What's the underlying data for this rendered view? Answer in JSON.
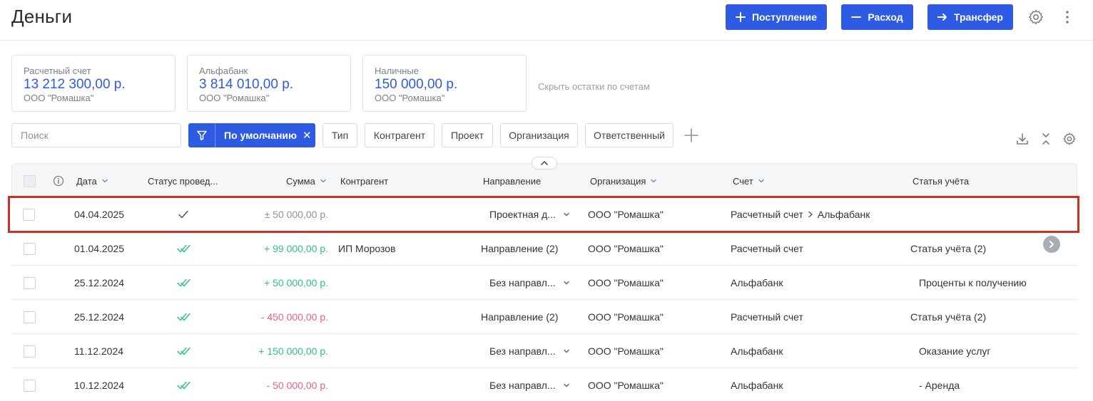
{
  "header": {
    "title": "Деньги",
    "income_label": "Поступление",
    "expense_label": "Расход",
    "transfer_label": "Трансфер"
  },
  "accounts": [
    {
      "name": "Расчетный счет",
      "amount": "13 212 300,00 р.",
      "org": "ООО \"Ромашка\""
    },
    {
      "name": "Альфабанк",
      "amount": "3 814 010,00 р.",
      "org": "ООО \"Ромашка\""
    },
    {
      "name": "Наличные",
      "amount": "150 000,00 р.",
      "org": "ООО \"Ромашка\""
    }
  ],
  "hide_balances_label": "Скрыть остатки по счетам",
  "filters": {
    "search_placeholder": "Поиск",
    "preset_label": "По умолчанию",
    "chips": [
      "Тип",
      "Контрагент",
      "Проект",
      "Организация",
      "Ответственный"
    ]
  },
  "table": {
    "columns": {
      "date": "Дата",
      "status": "Статус провед...",
      "amount": "Сумма",
      "counterparty": "Контрагент",
      "direction": "Направление",
      "organization": "Организация",
      "account": "Счет",
      "article": "Статья учёта"
    },
    "rows": [
      {
        "date": "04.04.2025",
        "status": "single",
        "amount": "± 50 000,00 р.",
        "amount_type": "neutral",
        "counterparty": "",
        "direction": "Проектная д...",
        "direction_dropdown": true,
        "organization": "ООО \"Ромашка\"",
        "account_from": "Расчетный счет",
        "account_to": "Альфабанк",
        "article": ""
      },
      {
        "date": "01.04.2025",
        "status": "double",
        "amount": "+ 99 000,00 р.",
        "amount_type": "pos",
        "counterparty": "ИП Морозов",
        "direction": "Направление (2)",
        "direction_dropdown": false,
        "organization": "ООО \"Ромашка\"",
        "account_from": "Расчетный счет",
        "account_to": "",
        "article": "Статья учёта (2)"
      },
      {
        "date": "25.12.2024",
        "status": "double",
        "amount": "+ 50 000,00 р.",
        "amount_type": "pos",
        "counterparty": "",
        "direction": "Без направл...",
        "direction_dropdown": true,
        "organization": "ООО \"Ромашка\"",
        "account_from": "Альфабанк",
        "account_to": "",
        "article": "Проценты к получению"
      },
      {
        "date": "25.12.2024",
        "status": "double",
        "amount": "- 450 000,00 р.",
        "amount_type": "neg",
        "counterparty": "",
        "direction": "Направление (2)",
        "direction_dropdown": false,
        "organization": "ООО \"Ромашка\"",
        "account_from": "Расчетный счет",
        "account_to": "",
        "article": "Статья учёта (2)"
      },
      {
        "date": "11.12.2024",
        "status": "double",
        "amount": "+ 150 000,00 р.",
        "amount_type": "pos",
        "counterparty": "",
        "direction": "Без направл...",
        "direction_dropdown": true,
        "organization": "ООО \"Ромашка\"",
        "account_from": "Альфабанк",
        "account_to": "",
        "article": "Оказание услуг"
      },
      {
        "date": "10.12.2024",
        "status": "double",
        "amount": "- 50 000,00 р.",
        "amount_type": "neg",
        "counterparty": "",
        "direction": "Без направл...",
        "direction_dropdown": true,
        "organization": "ООО \"Ромашка\"",
        "account_from": "Альфабанк",
        "account_to": "",
        "article": "- Аренда"
      }
    ]
  },
  "colors": {
    "primary": "#2d5be3",
    "positive": "#2fbf8f",
    "negative": "#f0607a",
    "highlight": "#c8321e"
  }
}
